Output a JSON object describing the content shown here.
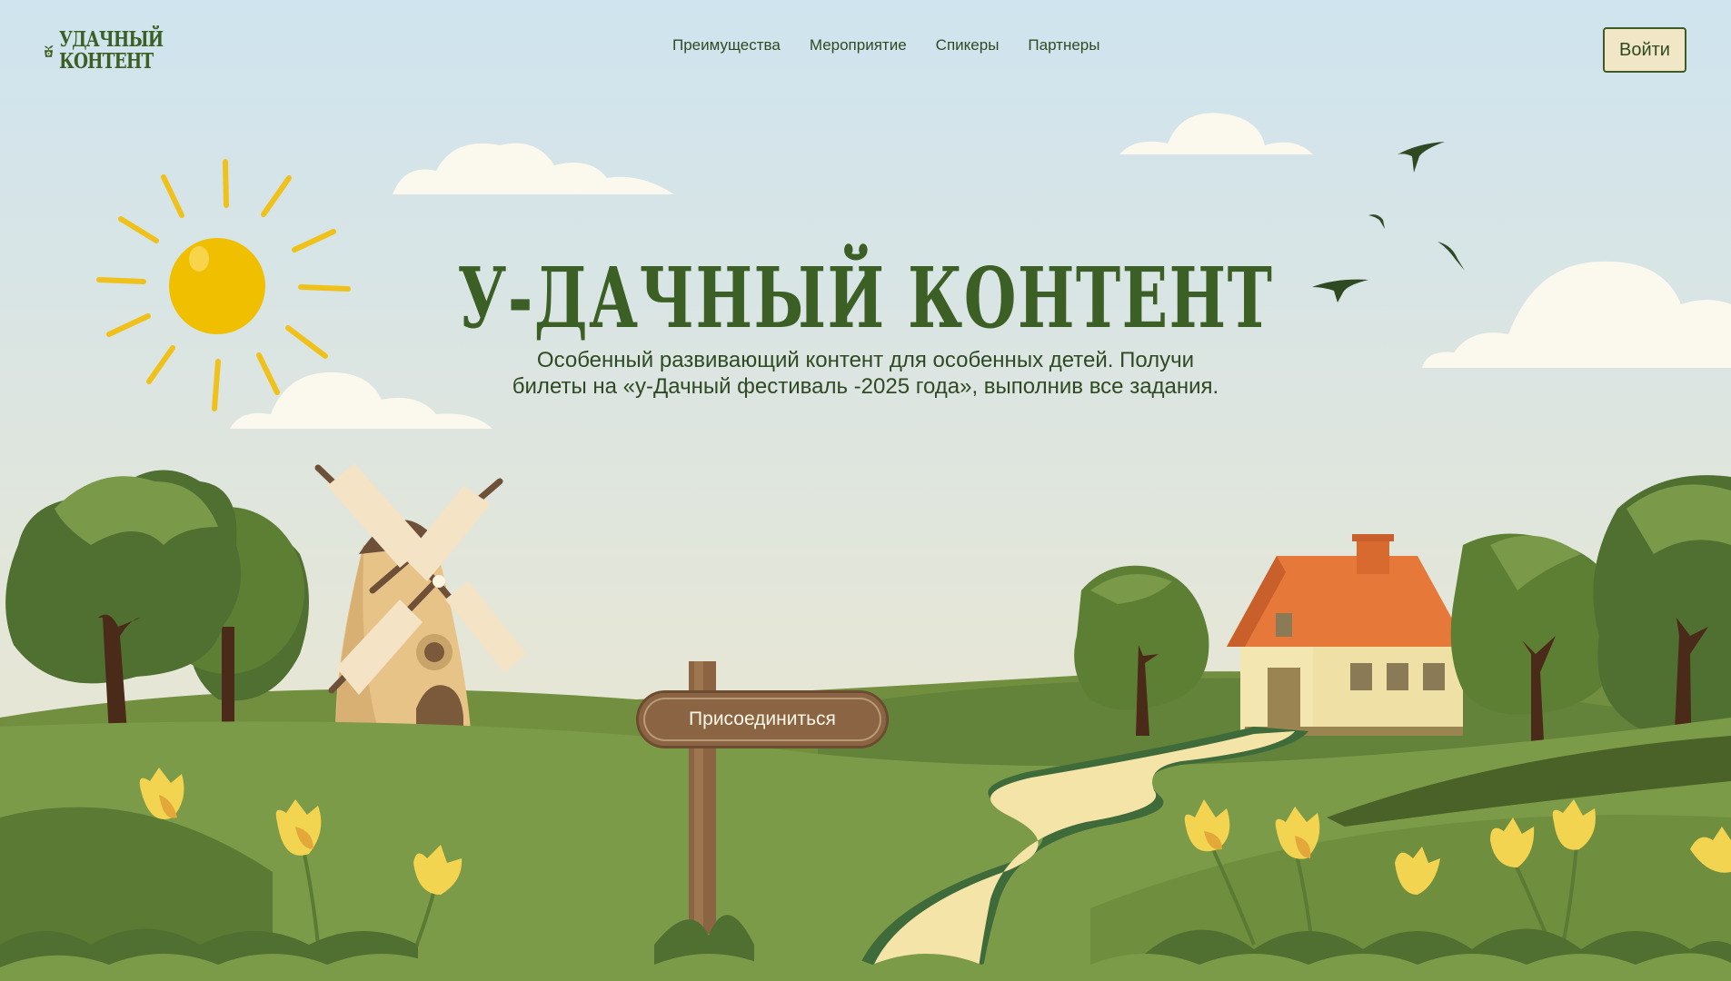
{
  "header": {
    "logo_line1": "УДАЧНЫЙ",
    "logo_line2": "КОНТЕНТ",
    "nav": [
      "Преимущества",
      "Мероприятие",
      "Спикеры",
      "Партнеры"
    ],
    "login_label": "Войти"
  },
  "hero": {
    "title": "У-ДАЧНЫЙ КОНТЕНТ",
    "subtitle": "Особенный развивающий контент для особенных детей. Получи билеты на «у-Дачный фестиваль -2025 года», выполнив все задания.",
    "cta_label": "Присоединиться"
  },
  "colors": {
    "brand_green": "#3b5f24",
    "sky_top": "#cfe4ef",
    "grass": "#7c9b49",
    "sun": "#f0bf00",
    "cta_brown": "#8b6443",
    "login_bg": "#f1e7c6"
  }
}
